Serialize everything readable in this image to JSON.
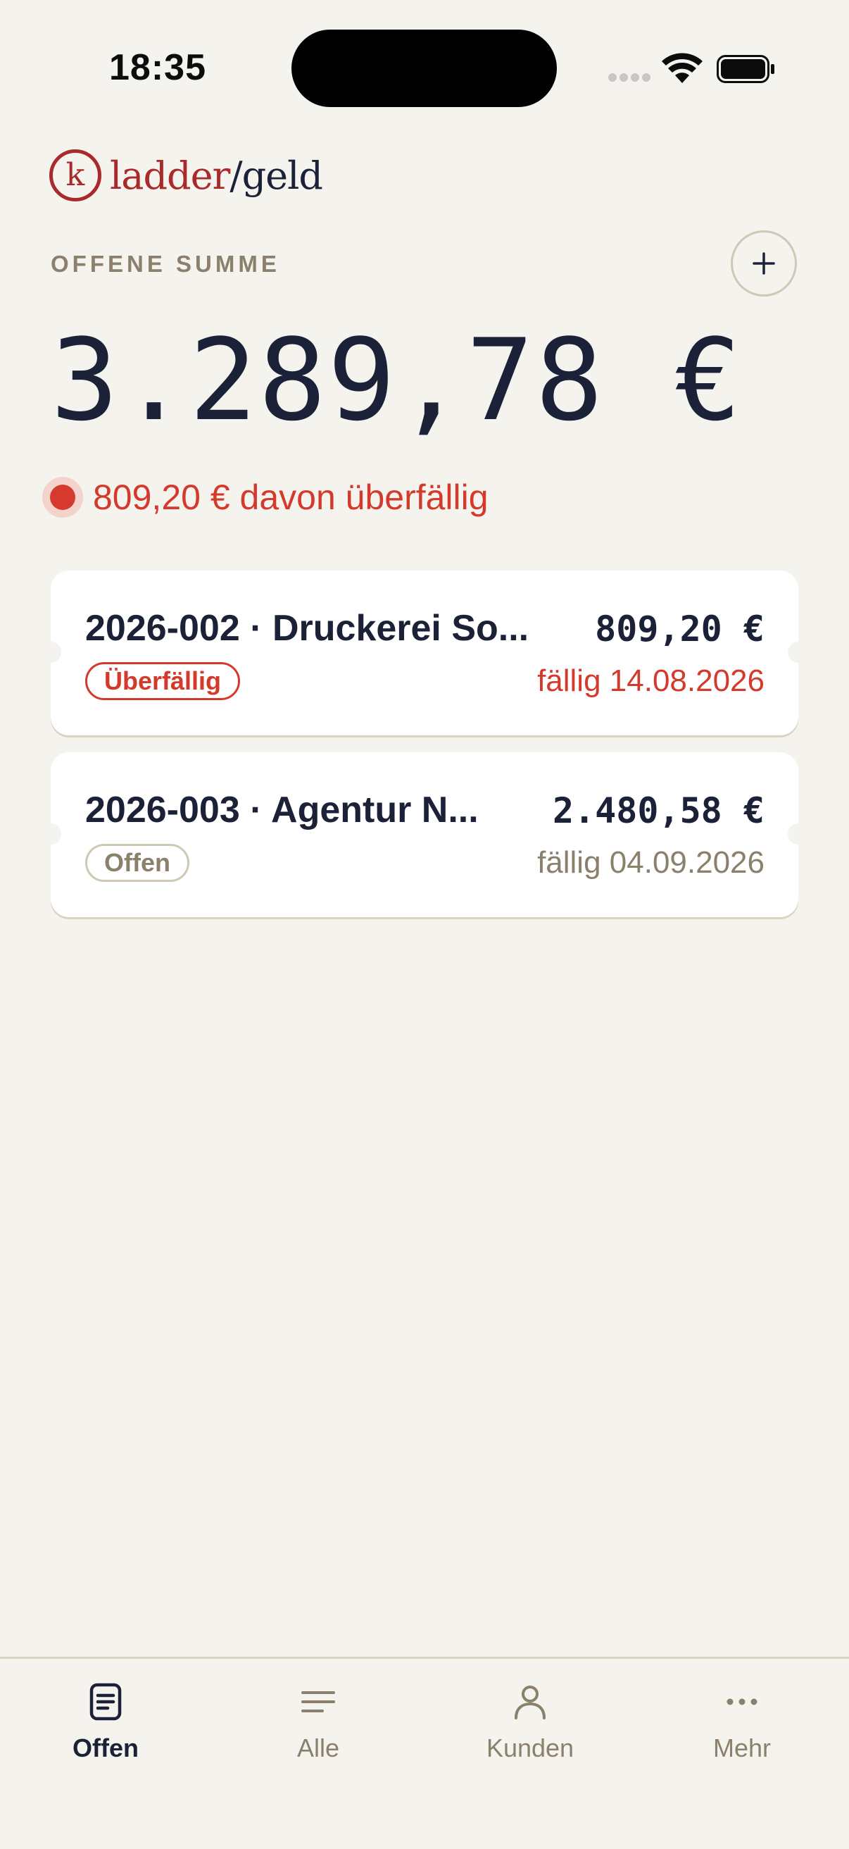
{
  "status_bar": {
    "time": "18:35"
  },
  "logo": {
    "mark": "k",
    "name_a": "ladder",
    "name_b": "/geld"
  },
  "summary": {
    "label": "OFFENE SUMME",
    "amount": "3.289,78 €",
    "overdue_text": "809,20 € davon überfällig",
    "add_icon": "plus-icon"
  },
  "invoices": [
    {
      "title": "2026-002 · Druckerei So...",
      "amount": "809,20 €",
      "status": "Überfällig",
      "due": "fällig 14.08.2026",
      "state": "overdue"
    },
    {
      "title": "2026-003 · Agentur N...",
      "amount": "2.480,58 €",
      "status": "Offen",
      "due": "fällig 04.09.2026",
      "state": "open"
    }
  ],
  "tabs": [
    {
      "label": "Offen",
      "icon": "document-icon",
      "active": true
    },
    {
      "label": "Alle",
      "icon": "list-icon",
      "active": false
    },
    {
      "label": "Kunden",
      "icon": "person-icon",
      "active": false
    },
    {
      "label": "Mehr",
      "icon": "more-icon",
      "active": false
    }
  ],
  "colors": {
    "accent_red": "#d43a2c",
    "brand_red": "#a82a2a",
    "ink": "#1b2238",
    "muted": "#8a806c",
    "background": "#f5f3ee"
  }
}
